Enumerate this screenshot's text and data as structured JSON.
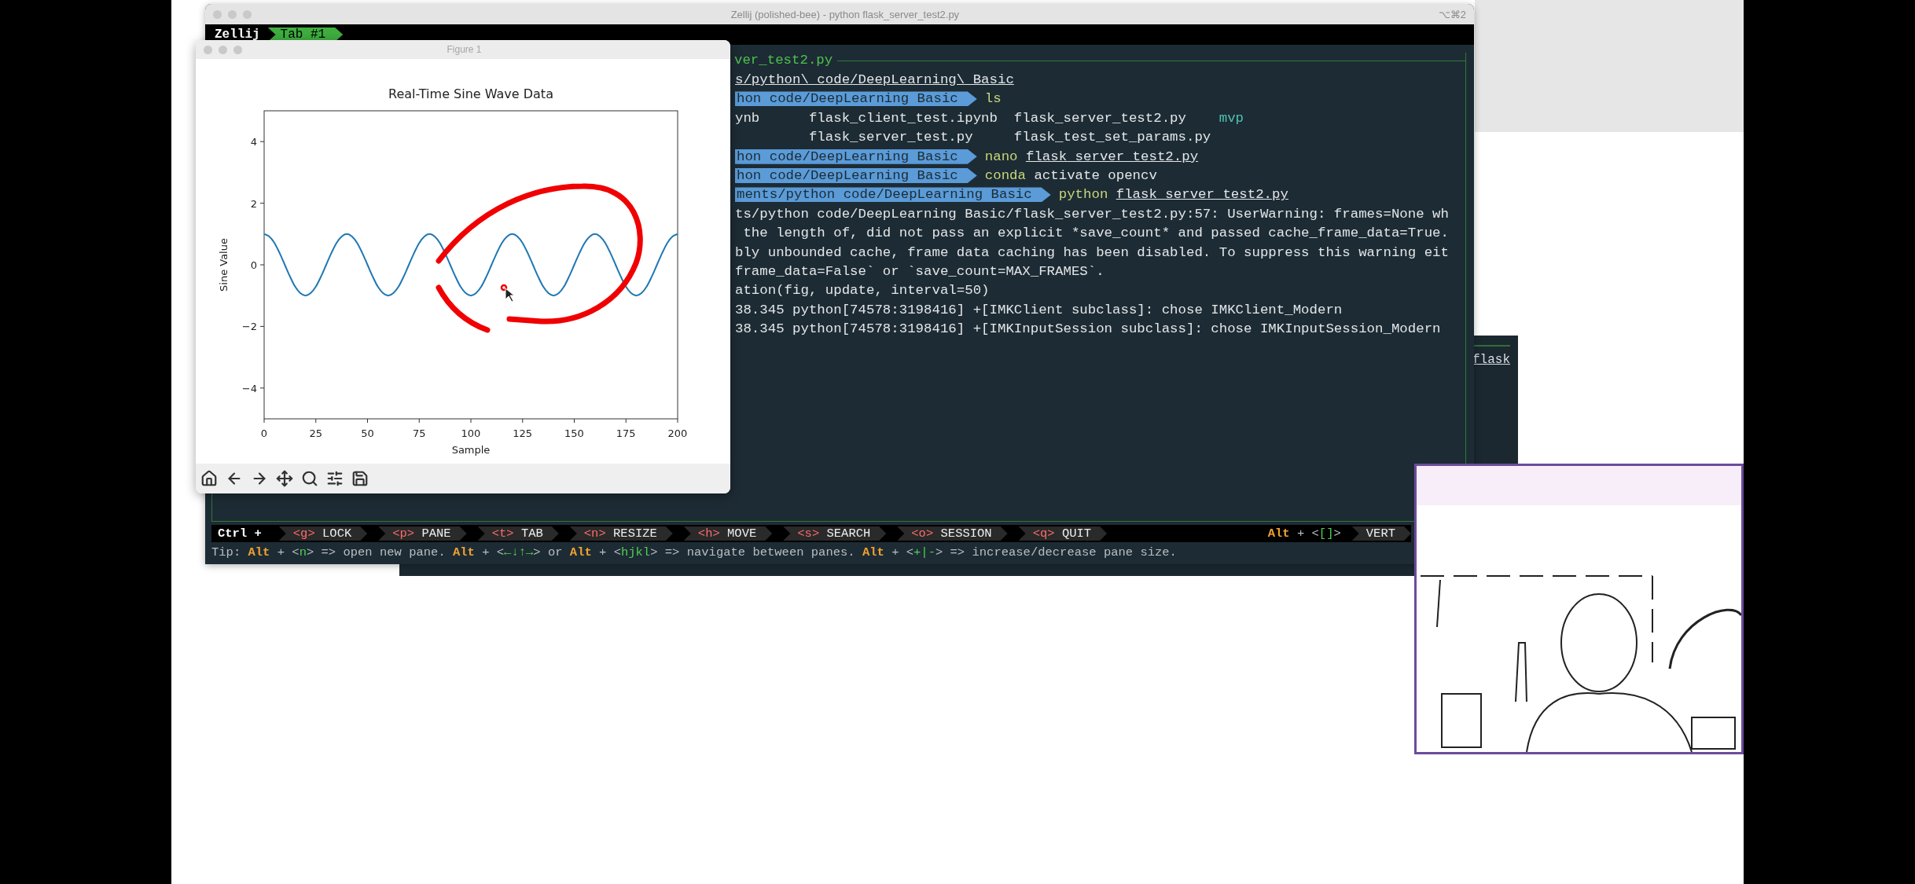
{
  "terminal": {
    "title": "Zellij (polished-bee) - python flask_server_test2.py",
    "shortcut": "⌥⌘2",
    "session": "Zellij",
    "tabs": [
      {
        "label": "Tab #1",
        "selected": true
      }
    ],
    "pane_title": "ver_test2.py",
    "lines": [
      {
        "kind": "output",
        "parts": [
          {
            "text": "s/python\\ code/DeepLearning\\ Basic",
            "kind": "file"
          }
        ]
      },
      {
        "kind": "prompt",
        "path": "hon code/DeepLearning Basic",
        "parts": [
          {
            "text": "ls",
            "kind": "cmd"
          }
        ]
      },
      {
        "kind": "output",
        "parts": [
          {
            "text": "ynb      flask_client_test.ipynb  flask_server_test2.py    ",
            "kind": "plain"
          },
          {
            "text": "mvp",
            "kind": "dir"
          }
        ]
      },
      {
        "kind": "output",
        "parts": [
          {
            "text": "         flask_server_test.py     flask_test_set_params.py",
            "kind": "plain"
          }
        ]
      },
      {
        "kind": "prompt",
        "path": "hon code/DeepLearning Basic",
        "parts": [
          {
            "text": "nano",
            "kind": "cmd"
          },
          {
            "text": "flask_server_test2.py",
            "kind": "file"
          }
        ]
      },
      {
        "kind": "prompt",
        "path": "hon code/DeepLearning Basic",
        "parts": [
          {
            "text": "conda",
            "kind": "cmd"
          },
          {
            "text": "activate opencv",
            "kind": "plain"
          }
        ]
      },
      {
        "kind": "prompt",
        "path": "ments/python code/DeepLearning Basic",
        "parts": [
          {
            "text": "python",
            "kind": "cmd"
          },
          {
            "text": "flask_server_test2.py",
            "kind": "file"
          }
        ]
      },
      {
        "kind": "output",
        "parts": [
          {
            "text": "ts/python code/DeepLearning Basic/flask_server_test2.py:57: UserWarning: frames=None wh",
            "kind": "plain"
          }
        ]
      },
      {
        "kind": "output",
        "parts": [
          {
            "text": " the length of, did not pass an explicit *save_count* and passed cache_frame_data=True.",
            "kind": "plain"
          }
        ]
      },
      {
        "kind": "output",
        "parts": [
          {
            "text": "bly unbounded cache, frame data caching has been disabled. To suppress this warning eit",
            "kind": "plain"
          }
        ]
      },
      {
        "kind": "output",
        "parts": [
          {
            "text": "frame_data=False` or `save_count=MAX_FRAMES`.",
            "kind": "plain"
          }
        ]
      },
      {
        "kind": "output",
        "parts": [
          {
            "text": "ation(fig, update, interval=50)",
            "kind": "plain"
          }
        ]
      },
      {
        "kind": "output",
        "parts": [
          {
            "text": "38.345 python[74578:3198416] +[IMKClient subclass]: chose IMKClient_Modern",
            "kind": "plain"
          }
        ]
      },
      {
        "kind": "output",
        "parts": [
          {
            "text": "38.345 python[74578:3198416] +[IMKInputSession subclass]: chose IMKInputSession_Modern",
            "kind": "plain"
          }
        ]
      }
    ],
    "keybar": {
      "modifier": "Ctrl +",
      "items": [
        {
          "key": "<g>",
          "label": "LOCK"
        },
        {
          "key": "<p>",
          "label": "PANE"
        },
        {
          "key": "<t>",
          "label": "TAB"
        },
        {
          "key": "<n>",
          "label": "RESIZE"
        },
        {
          "key": "<h>",
          "label": "MOVE"
        },
        {
          "key": "<s>",
          "label": "SEARCH"
        },
        {
          "key": "<o>",
          "label": "SESSION"
        },
        {
          "key": "<q>",
          "label": "QUIT"
        }
      ],
      "hint": [
        {
          "text": "Alt",
          "kind": "mod"
        },
        {
          "text": " + <",
          "kind": "text"
        },
        {
          "text": "[]",
          "kind": "key"
        },
        {
          "text": ">",
          "kind": "text"
        }
      ],
      "cut_item": "VERT"
    },
    "tip": [
      {
        "text": "Tip: ",
        "kind": "text"
      },
      {
        "text": "Alt",
        "kind": "mod"
      },
      {
        "text": " + <",
        "kind": "text"
      },
      {
        "text": "n",
        "kind": "key"
      },
      {
        "text": "> => open new pane. ",
        "kind": "text"
      },
      {
        "text": "Alt",
        "kind": "mod"
      },
      {
        "text": " + <",
        "kind": "text"
      },
      {
        "text": "←↓↑→",
        "kind": "key"
      },
      {
        "text": "> or ",
        "kind": "text"
      },
      {
        "text": "Alt",
        "kind": "mod"
      },
      {
        "text": " + <",
        "kind": "text"
      },
      {
        "text": "hjkl",
        "kind": "key"
      },
      {
        "text": "> => navigate between panes. ",
        "kind": "text"
      },
      {
        "text": "Alt",
        "kind": "mod"
      },
      {
        "text": " + <",
        "kind": "text"
      },
      {
        "text": "+|-",
        "kind": "key"
      },
      {
        "text": "> => increase/decrease pane size.",
        "kind": "text"
      }
    ]
  },
  "side_window": {
    "pane_text": "flask"
  },
  "figure": {
    "title": "Figure 1",
    "chart_data": {
      "type": "line",
      "title": "Real-Time Sine Wave Data",
      "xlabel": "Sample",
      "ylabel": "Sine Value",
      "x": [
        0,
        2.5,
        5,
        7.5,
        10,
        12.5,
        15,
        17.5,
        20,
        22.5,
        25,
        27.5,
        30,
        32.5,
        35,
        37.5,
        40,
        42.5,
        45,
        47.5,
        50,
        52.5,
        55,
        57.5,
        60,
        62.5,
        65,
        67.5,
        70,
        72.5,
        75,
        77.5,
        80,
        82.5,
        85,
        87.5,
        90,
        92.5,
        95,
        97.5,
        100,
        102.5,
        105,
        107.5,
        110,
        112.5,
        115,
        117.5,
        120,
        122.5,
        125,
        127.5,
        130,
        132.5,
        135,
        137.5,
        140,
        142.5,
        145,
        147.5,
        150,
        152.5,
        155,
        157.5,
        160,
        162.5,
        165,
        167.5,
        170,
        172.5,
        175,
        177.5,
        180,
        182.5,
        185,
        187.5,
        190,
        192.5,
        195,
        197.5,
        200
      ],
      "series": [
        {
          "color": "#1f77b4",
          "values": [
            1,
            0.92,
            0.71,
            0.38,
            0,
            -0.38,
            -0.71,
            -0.92,
            -1,
            -0.92,
            -0.71,
            -0.38,
            0,
            0.38,
            0.71,
            0.92,
            1,
            0.92,
            0.71,
            0.38,
            0,
            -0.38,
            -0.71,
            -0.92,
            -1,
            -0.92,
            -0.71,
            -0.38,
            0,
            0.38,
            0.71,
            0.92,
            1,
            0.92,
            0.71,
            0.38,
            0,
            -0.38,
            -0.71,
            -0.92,
            -1,
            -0.92,
            -0.71,
            -0.38,
            0,
            0.38,
            0.71,
            0.92,
            1,
            0.92,
            0.71,
            0.38,
            0,
            -0.38,
            -0.71,
            -0.92,
            -1,
            -0.92,
            -0.71,
            -0.38,
            0,
            0.38,
            0.71,
            0.92,
            1,
            0.92,
            0.71,
            0.38,
            0,
            -0.38,
            -0.71,
            -0.92,
            -1,
            -0.92,
            -0.71,
            -0.38,
            0,
            0.38,
            0.71,
            0.92,
            1
          ]
        }
      ],
      "xlim": [
        0,
        200
      ],
      "ylim": [
        -5,
        5
      ],
      "xticks": [
        0,
        25,
        50,
        75,
        100,
        125,
        150,
        175,
        200
      ],
      "yticks": [
        {
          "value": -4,
          "label": "−4"
        },
        {
          "value": -2,
          "label": "−2"
        },
        {
          "value": 0,
          "label": "0"
        },
        {
          "value": 2,
          "label": "2"
        },
        {
          "value": 4,
          "label": "4"
        }
      ]
    }
  }
}
